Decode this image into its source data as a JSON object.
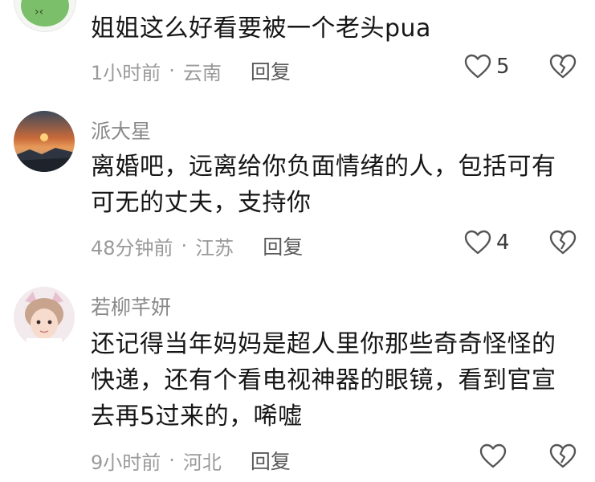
{
  "comments": [
    {
      "username": "",
      "text": "姐姐这么好看要被一个老头pua",
      "time": "1小时前",
      "location": "云南",
      "reply_label": "回复",
      "like_count": "5",
      "avatar": "green-cartoon-avatar"
    },
    {
      "username": "派大星",
      "text": "离婚吧，远离给你负面情绪的人，包括可有可无的丈夫，支持你",
      "time": "48分钟前",
      "location": "江苏",
      "reply_label": "回复",
      "like_count": "4",
      "avatar": "sunset-landscape-avatar"
    },
    {
      "username": "若柳芊妍",
      "text": "还记得当年妈妈是超人里你那些奇奇怪怪的快递，还有个看电视神器的眼镜，看到官宣去再5过来的，唏嘘",
      "time": "9小时前",
      "location": "河北",
      "reply_label": "回复",
      "like_count": "",
      "avatar": "girl-bunny-ears-avatar"
    }
  ],
  "separator": "·",
  "colors": {
    "text": "#161616",
    "meta": "#9a9a9a",
    "username": "#8a8a8a",
    "icon": "#555555"
  }
}
